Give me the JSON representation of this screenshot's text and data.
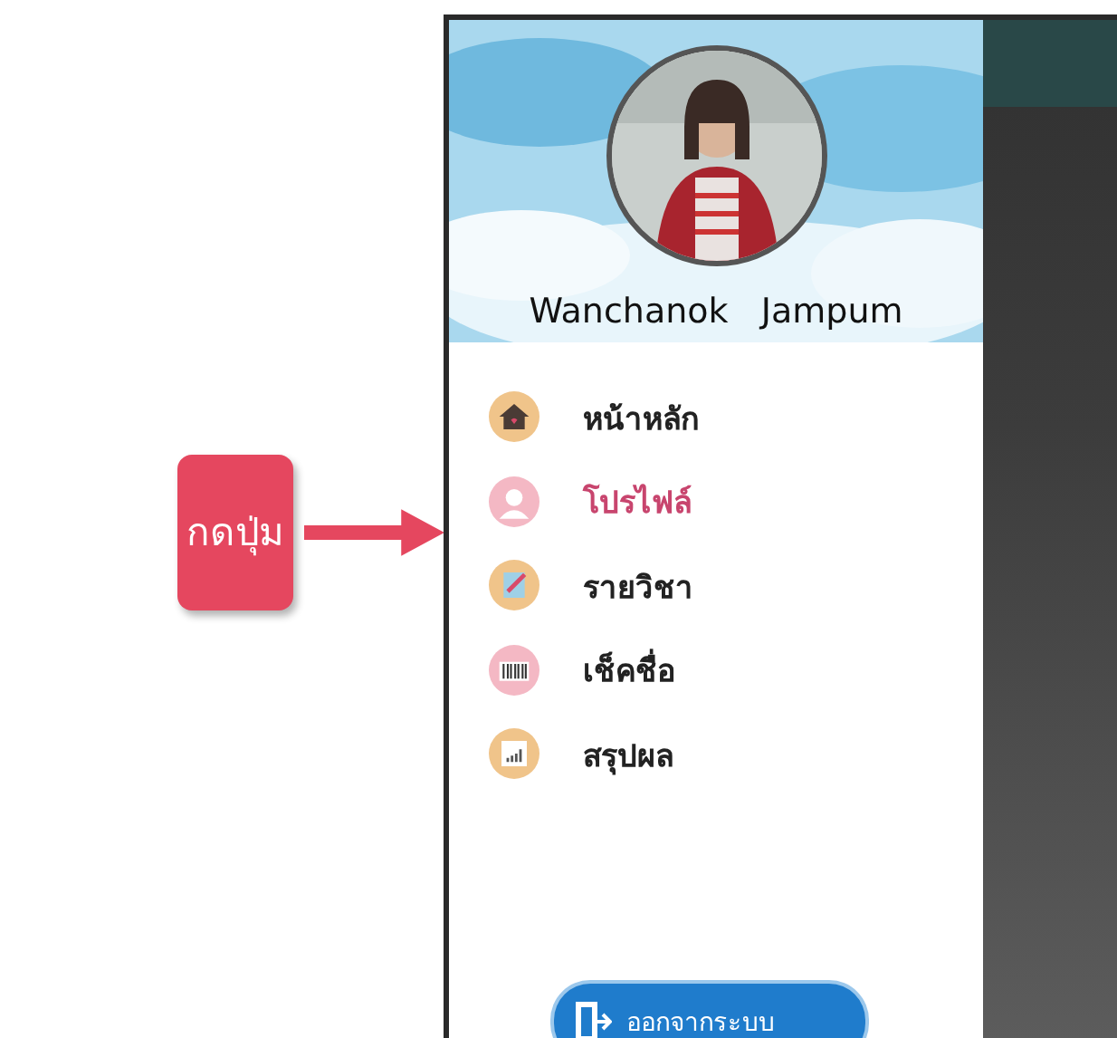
{
  "callout": {
    "label": "กดปุ่ม"
  },
  "profile": {
    "name": "Wanchanok   Jampum"
  },
  "menu": [
    {
      "label": "หน้าหลัก",
      "kind": "home",
      "selected": false
    },
    {
      "label": "โปรไฟล์",
      "kind": "person",
      "selected": true
    },
    {
      "label": "รายวิชา",
      "kind": "book",
      "selected": false
    },
    {
      "label": "เช็คชื่อ",
      "kind": "barcode",
      "selected": false
    },
    {
      "label": "สรุปผล",
      "kind": "chart",
      "selected": false
    }
  ],
  "logout": {
    "label": "ออกจากระบบ"
  }
}
